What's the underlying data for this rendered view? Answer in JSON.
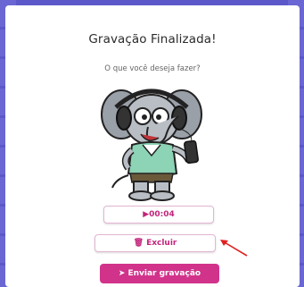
{
  "dialog": {
    "title": "Gravação Finalizada!",
    "subtitle": "O que você deseja fazer?"
  },
  "buttons": {
    "time_label": "▶00:04",
    "delete_icon": "🗑",
    "delete_label": "Excluir",
    "send_icon": "➤",
    "send_label": "Enviar gravação"
  },
  "colors": {
    "background": "#5b58c9",
    "accent": "#d1338b",
    "accent_text": "#c2247a",
    "arrow": "#e02020"
  },
  "icons": {
    "mascot": "elephant-mascot-with-headphones-and-phone",
    "delete": "trash-icon",
    "send": "send-arrow-icon",
    "annotation": "red-arrow-annotation"
  }
}
